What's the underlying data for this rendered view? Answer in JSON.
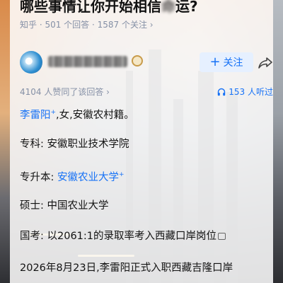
{
  "question": {
    "title_prefix": "哪些事情让你开始相信",
    "title_obscured": "命",
    "title_suffix": "运?",
    "meta": "知乎 · 501 个回答 · 1587 个关注 ›"
  },
  "author": {
    "follow_label": "关注",
    "follow_plus": "+"
  },
  "stats": {
    "likes": "4104 人赞同了该回答 ›",
    "listens": "153 人听过"
  },
  "answer": {
    "name": "李雷阳",
    "sup": "+",
    "intro": ",女,安徽农村籍。",
    "line2_label": "专科:",
    "line2_value": "安徽职业技术学院",
    "line3_label": "专升本:",
    "line3_value": "安徽农业大学",
    "line3_sup": "+",
    "line4_label": "硕士:",
    "line4_value": "中国农业大学",
    "line5_label": "国考:",
    "line5_value": "以2061:1的录取率考入西藏口岸岗位",
    "line6": "2026年8月23日,李雷阳正式入职西藏吉隆口岸"
  },
  "colors": {
    "accent": "#1772f6",
    "meta": "#8590a6"
  }
}
